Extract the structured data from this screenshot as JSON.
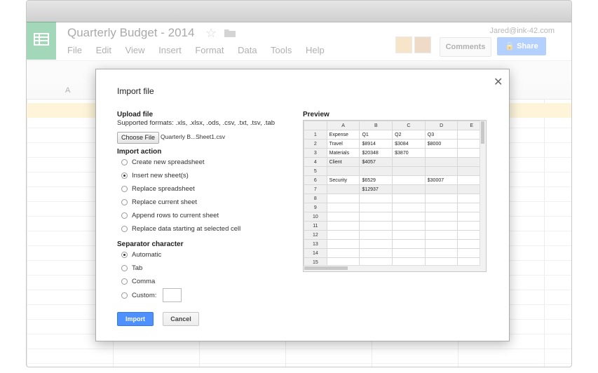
{
  "app": {
    "title": "Quarterly Budget - 2014",
    "user_email": "Jared@ink-42.com",
    "menu": [
      "File",
      "Edit",
      "View",
      "Insert",
      "Format",
      "Data",
      "Tools",
      "Help"
    ],
    "comments_label": "Comments",
    "share_label": "Share",
    "column_a_label": "A",
    "brand_color": "#24a15b",
    "accent_color": "#4d90fe"
  },
  "dialog": {
    "title": "Import file",
    "upload": {
      "heading": "Upload file",
      "formats": "Supported formats: .xls, .xlsx, .ods, .csv, .txt, .tsv, .tab",
      "choose_label": "Choose File",
      "file_name": "Quarterly B...Sheet1.csv"
    },
    "import_action": {
      "heading": "Import action",
      "options": [
        {
          "label": "Create new spreadsheet",
          "selected": false
        },
        {
          "label": "Insert new sheet(s)",
          "selected": true
        },
        {
          "label": "Replace spreadsheet",
          "selected": false
        },
        {
          "label": "Replace current sheet",
          "selected": false
        },
        {
          "label": "Append rows to current sheet",
          "selected": false
        },
        {
          "label": "Replace data starting at selected cell",
          "selected": false
        }
      ]
    },
    "separator": {
      "heading": "Separator character",
      "options": [
        {
          "label": "Automatic",
          "selected": true
        },
        {
          "label": "Tab",
          "selected": false
        },
        {
          "label": "Comma",
          "selected": false
        },
        {
          "label": "Custom:",
          "selected": false
        }
      ],
      "custom_value": ""
    },
    "import_label": "Import",
    "cancel_label": "Cancel",
    "preview": {
      "heading": "Preview",
      "columns": [
        "A",
        "B",
        "C",
        "D",
        "E"
      ],
      "rows": [
        [
          "1",
          "Expense",
          "Q1",
          "Q2",
          "Q3",
          ""
        ],
        [
          "2",
          "Travel",
          "$8914",
          "$3084",
          "$8000",
          ""
        ],
        [
          "3",
          "Materials",
          "$20348",
          "$3870",
          "",
          ""
        ],
        [
          "4",
          "Client",
          "$4057",
          "",
          "",
          ""
        ],
        [
          "5",
          "",
          "",
          "",
          "",
          ""
        ],
        [
          "6",
          "Security",
          "$6529",
          "",
          "$30007",
          ""
        ],
        [
          "7",
          "",
          "$12937",
          "",
          "",
          ""
        ],
        [
          "8",
          "",
          "",
          "",
          "",
          ""
        ],
        [
          "9",
          "",
          "",
          "",
          "",
          ""
        ],
        [
          "10",
          "",
          "",
          "",
          "",
          ""
        ],
        [
          "11",
          "",
          "",
          "",
          "",
          ""
        ],
        [
          "12",
          "",
          "",
          "",
          "",
          ""
        ],
        [
          "13",
          "",
          "",
          "",
          "",
          ""
        ],
        [
          "14",
          "",
          "",
          "",
          "",
          ""
        ],
        [
          "15",
          "",
          "",
          "",
          "",
          ""
        ]
      ]
    }
  }
}
